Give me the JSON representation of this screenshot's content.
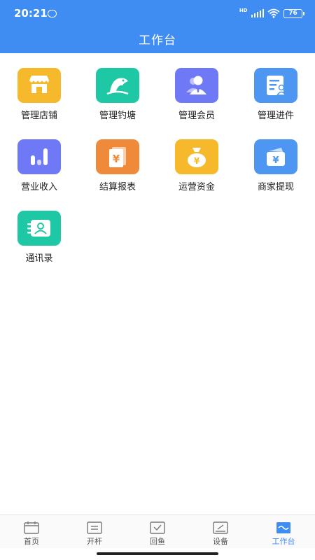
{
  "status_bar": {
    "time": "20:21",
    "network_label": "HD",
    "battery_level": "76",
    "app_icon": "app-notification-icon"
  },
  "header": {
    "title": "工作台",
    "background_color": "#3f8cf3"
  },
  "workbench": {
    "items": [
      {
        "label": "管理店铺",
        "icon": "storefront-icon",
        "color": "#f6b92c"
      },
      {
        "label": "管理钓塘",
        "icon": "fish-pond-icon",
        "color": "#1fc8a5"
      },
      {
        "label": "管理会员",
        "icon": "member-icon",
        "color": "#6f79f5"
      },
      {
        "label": "管理进件",
        "icon": "application-form-icon",
        "color": "#4d97f3"
      },
      {
        "label": "营业收入",
        "icon": "bar-chart-icon",
        "color": "#6f79f5"
      },
      {
        "label": "结算报表",
        "icon": "settlement-report-icon",
        "color": "#f08a3b"
      },
      {
        "label": "运营资金",
        "icon": "money-bag-icon",
        "color": "#f6b92c"
      },
      {
        "label": "商家提现",
        "icon": "wallet-withdraw-icon",
        "color": "#4d97f3"
      },
      {
        "label": "通讯录",
        "icon": "contacts-icon",
        "color": "#1fc8a5"
      }
    ]
  },
  "tabbar": {
    "active_color": "#3f8cf3",
    "tabs": [
      {
        "label": "首页",
        "icon": "home-calendar-icon",
        "active": false
      },
      {
        "label": "开杆",
        "icon": "start-rod-icon",
        "active": false
      },
      {
        "label": "回鱼",
        "icon": "return-fish-icon",
        "active": false
      },
      {
        "label": "设备",
        "icon": "device-icon",
        "active": false
      },
      {
        "label": "工作台",
        "icon": "workbench-icon",
        "active": true
      }
    ]
  }
}
